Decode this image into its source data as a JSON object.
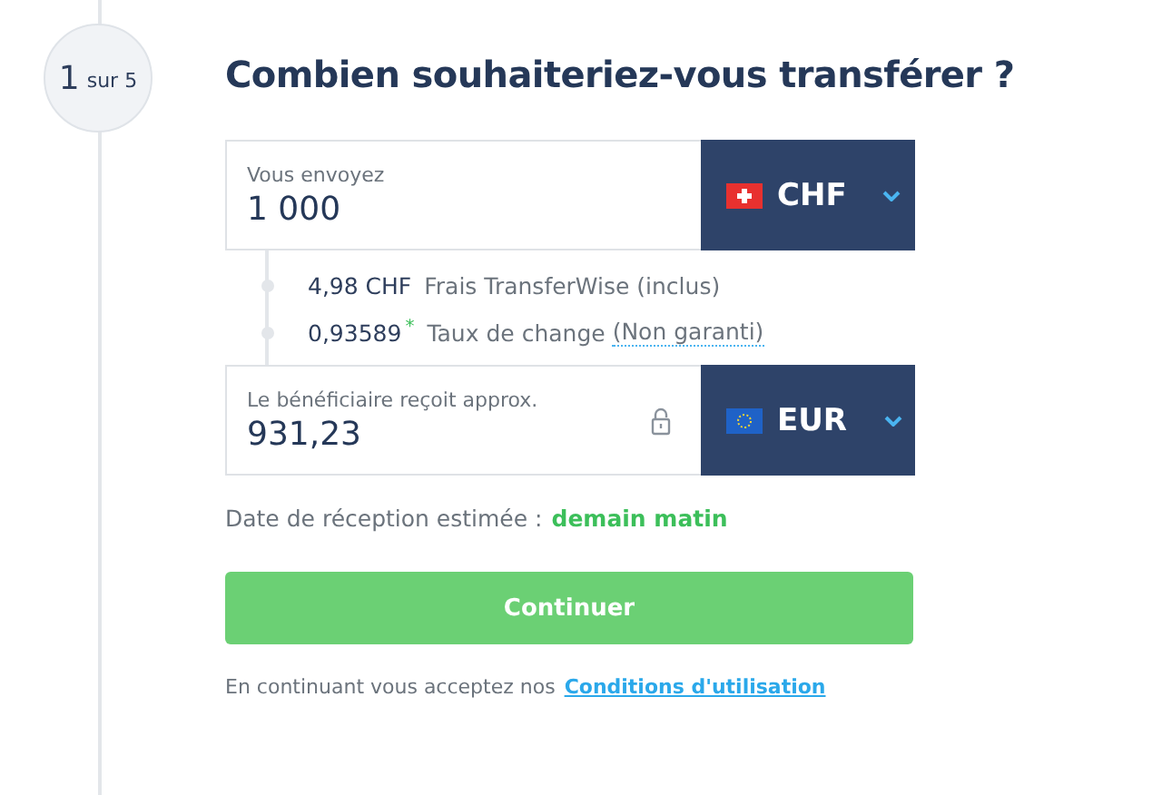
{
  "step": {
    "number": "1",
    "of_text": "sur 5"
  },
  "title": "Combien souhaiteriez-vous transférer ?",
  "send": {
    "label": "Vous envoyez",
    "value": "1 000",
    "currency": "CHF",
    "kind": "swiss"
  },
  "fees": [
    {
      "amount": "4,98 CHF",
      "label": "Frais TransferWise (inclus)"
    },
    {
      "amount": "0,93589",
      "mark": "*",
      "label": "Taux de change",
      "note": "(Non garanti)"
    }
  ],
  "receive": {
    "label": "Le bénéficiaire reçoit approx.",
    "value": "931,23",
    "locked": true,
    "currency": "EUR",
    "kind": "eu"
  },
  "delivery": {
    "label": "Date de réception estimée :",
    "value": "demain matin"
  },
  "button": "Continuer",
  "terms": {
    "text": "En continuant vous acceptez nos",
    "link": "Conditions d'utilisation"
  }
}
